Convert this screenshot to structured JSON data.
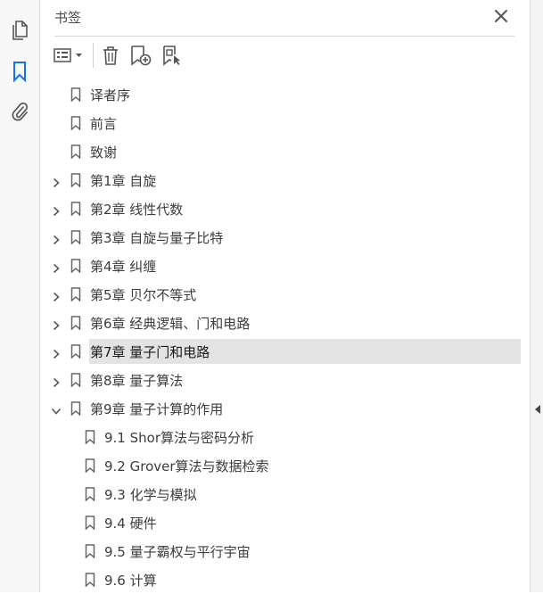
{
  "panel": {
    "title": "书签"
  },
  "rail": {
    "icons": [
      "pages-icon",
      "bookmark-icon",
      "attachment-icon"
    ],
    "accent": "#1473e6"
  },
  "toolbar": {
    "icons": [
      "options-menu-icon",
      "delete-bookmark-icon",
      "new-bookmark-icon",
      "bookmark-from-structure-icon"
    ]
  },
  "bookmarks": [
    {
      "label": "译者序",
      "level": 0,
      "expander": "none"
    },
    {
      "label": "前言",
      "level": 0,
      "expander": "none"
    },
    {
      "label": "致谢",
      "level": 0,
      "expander": "none"
    },
    {
      "label": "第1章 自旋",
      "level": 0,
      "expander": "collapsed"
    },
    {
      "label": "第2章 线性代数",
      "level": 0,
      "expander": "collapsed"
    },
    {
      "label": "第3章 自旋与量子比特",
      "level": 0,
      "expander": "collapsed"
    },
    {
      "label": "第4章 纠缠",
      "level": 0,
      "expander": "collapsed"
    },
    {
      "label": "第5章 贝尔不等式",
      "level": 0,
      "expander": "collapsed"
    },
    {
      "label": "第6章 经典逻辑、门和电路",
      "level": 0,
      "expander": "collapsed"
    },
    {
      "label": "第7章 量子门和电路",
      "level": 0,
      "expander": "collapsed",
      "selected": true
    },
    {
      "label": "第8章 量子算法",
      "level": 0,
      "expander": "collapsed"
    },
    {
      "label": "第9章 量子计算的作用",
      "level": 0,
      "expander": "expanded"
    },
    {
      "label": "9.1 Shor算法与密码分析",
      "level": 1,
      "expander": "none"
    },
    {
      "label": "9.2 Grover算法与数据检索",
      "level": 1,
      "expander": "none"
    },
    {
      "label": "9.3 化学与模拟",
      "level": 1,
      "expander": "none"
    },
    {
      "label": "9.4 硬件",
      "level": 1,
      "expander": "none"
    },
    {
      "label": "9.5 量子霸权与平行宇宙",
      "level": 1,
      "expander": "none"
    },
    {
      "label": "9.6 计算",
      "level": 1,
      "expander": "none"
    }
  ]
}
